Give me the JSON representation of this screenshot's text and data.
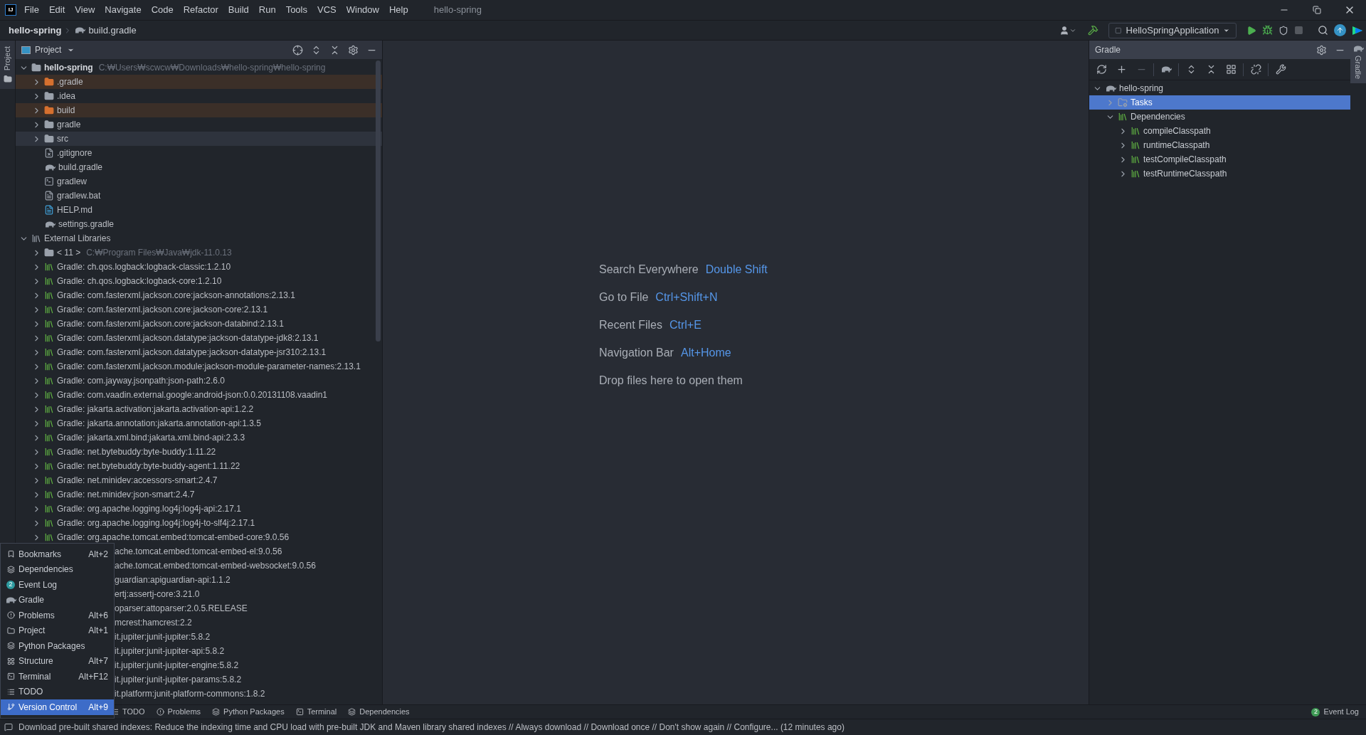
{
  "window": {
    "logo_text": "IJ",
    "title": "hello-spring",
    "menu": [
      "File",
      "Edit",
      "View",
      "Navigate",
      "Code",
      "Refactor",
      "Build",
      "Run",
      "Tools",
      "VCS",
      "Window",
      "Help"
    ]
  },
  "navbar": {
    "breadcrumbs": [
      "hello-spring",
      "build.gradle"
    ],
    "run_config": "HelloSpringApplication"
  },
  "left_strip": {
    "label": "Project"
  },
  "project": {
    "title": "Project",
    "tree": [
      {
        "kind": "module",
        "label": "hello-spring",
        "path": "C:₩Users₩scwcw₩Downloads₩hello-spring₩hello-spring",
        "expanded": true,
        "selected": false,
        "children": [
          {
            "kind": "excluded",
            "label": ".gradle",
            "expanded": false,
            "selected": false
          },
          {
            "kind": "folder",
            "label": ".idea",
            "expanded": false,
            "selected": false
          },
          {
            "kind": "excluded",
            "label": "build",
            "expanded": false,
            "selected": false
          },
          {
            "kind": "folder",
            "label": "gradle",
            "expanded": false,
            "selected": false
          },
          {
            "kind": "folder",
            "label": "src",
            "expanded": false,
            "selected": true
          },
          {
            "kind": "gitignore",
            "label": ".gitignore",
            "selected": false
          },
          {
            "kind": "gradle-file",
            "label": "build.gradle",
            "selected": false
          },
          {
            "kind": "script",
            "label": "gradlew",
            "selected": false
          },
          {
            "kind": "text-file",
            "label": "gradlew.bat",
            "selected": false
          },
          {
            "kind": "markdown",
            "label": "HELP.md",
            "selected": false
          },
          {
            "kind": "gradle-file",
            "label": "settings.gradle",
            "selected": false
          }
        ]
      },
      {
        "kind": "libraries",
        "label": "External Libraries",
        "expanded": true,
        "selected": false,
        "children": [
          {
            "kind": "jdk",
            "label": "< 11 >",
            "path": "C:₩Program Files₩Java₩jdk-11.0.13",
            "expanded": false,
            "selected": false
          },
          {
            "kind": "library",
            "label": "Gradle: ch.qos.logback:logback-classic:1.2.10",
            "expanded": false,
            "selected": false
          },
          {
            "kind": "library",
            "label": "Gradle: ch.qos.logback:logback-core:1.2.10",
            "expanded": false,
            "selected": false
          },
          {
            "kind": "library",
            "label": "Gradle: com.fasterxml.jackson.core:jackson-annotations:2.13.1",
            "expanded": false,
            "selected": false
          },
          {
            "kind": "library",
            "label": "Gradle: com.fasterxml.jackson.core:jackson-core:2.13.1",
            "expanded": false,
            "selected": false
          },
          {
            "kind": "library",
            "label": "Gradle: com.fasterxml.jackson.core:jackson-databind:2.13.1",
            "expanded": false,
            "selected": false
          },
          {
            "kind": "library",
            "label": "Gradle: com.fasterxml.jackson.datatype:jackson-datatype-jdk8:2.13.1",
            "expanded": false,
            "selected": false
          },
          {
            "kind": "library",
            "label": "Gradle: com.fasterxml.jackson.datatype:jackson-datatype-jsr310:2.13.1",
            "expanded": false,
            "selected": false
          },
          {
            "kind": "library",
            "label": "Gradle: com.fasterxml.jackson.module:jackson-module-parameter-names:2.13.1",
            "expanded": false,
            "selected": false
          },
          {
            "kind": "library",
            "label": "Gradle: com.jayway.jsonpath:json-path:2.6.0",
            "expanded": false,
            "selected": false
          },
          {
            "kind": "library",
            "label": "Gradle: com.vaadin.external.google:android-json:0.0.20131108.vaadin1",
            "expanded": false,
            "selected": false
          },
          {
            "kind": "library",
            "label": "Gradle: jakarta.activation:jakarta.activation-api:1.2.2",
            "expanded": false,
            "selected": false
          },
          {
            "kind": "library",
            "label": "Gradle: jakarta.annotation:jakarta.annotation-api:1.3.5",
            "expanded": false,
            "selected": false
          },
          {
            "kind": "library",
            "label": "Gradle: jakarta.xml.bind:jakarta.xml.bind-api:2.3.3",
            "expanded": false,
            "selected": false
          },
          {
            "kind": "library",
            "label": "Gradle: net.bytebuddy:byte-buddy:1.11.22",
            "expanded": false,
            "selected": false
          },
          {
            "kind": "library",
            "label": "Gradle: net.bytebuddy:byte-buddy-agent:1.11.22",
            "expanded": false,
            "selected": false
          },
          {
            "kind": "library",
            "label": "Gradle: net.minidev:accessors-smart:2.4.7",
            "expanded": false,
            "selected": false
          },
          {
            "kind": "library",
            "label": "Gradle: net.minidev:json-smart:2.4.7",
            "expanded": false,
            "selected": false
          },
          {
            "kind": "library",
            "label": "Gradle: org.apache.logging.log4j:log4j-api:2.17.1",
            "expanded": false,
            "selected": false
          },
          {
            "kind": "library",
            "label": "Gradle: org.apache.logging.log4j:log4j-to-slf4j:2.17.1",
            "expanded": false,
            "selected": false
          },
          {
            "kind": "library",
            "label": "Gradle: org.apache.tomcat.embed:tomcat-embed-core:9.0.56",
            "expanded": false,
            "selected": false
          },
          {
            "kind": "clipped",
            "label": "ache.tomcat.embed:tomcat-embed-el:9.0.56",
            "selected": false
          },
          {
            "kind": "clipped",
            "label": "ache.tomcat.embed:tomcat-embed-websocket:9.0.56",
            "selected": false
          },
          {
            "kind": "clipped",
            "label": "guardian:apiguardian-api:1.1.2",
            "selected": false
          },
          {
            "kind": "clipped",
            "label": "ertj:assertj-core:3.21.0",
            "selected": false
          },
          {
            "kind": "clipped",
            "label": "oparser:attoparser:2.0.5.RELEASE",
            "selected": false
          },
          {
            "kind": "clipped",
            "label": "mcrest:hamcrest:2.2",
            "selected": false
          },
          {
            "kind": "clipped",
            "label": "it.jupiter:junit-jupiter:5.8.2",
            "selected": false
          },
          {
            "kind": "clipped",
            "label": "it.jupiter:junit-jupiter-api:5.8.2",
            "selected": false
          },
          {
            "kind": "clipped",
            "label": "it.jupiter:junit-jupiter-engine:5.8.2",
            "selected": false
          },
          {
            "kind": "clipped",
            "label": "it.jupiter:junit-jupiter-params:5.8.2",
            "selected": false
          },
          {
            "kind": "clipped",
            "label": "it.platform:junit-platform-commons:1.8.2",
            "selected": false
          }
        ]
      }
    ]
  },
  "editor": {
    "hints": [
      {
        "label": "Search Everywhere",
        "shortcut": "Double Shift"
      },
      {
        "label": "Go to File",
        "shortcut": "Ctrl+Shift+N"
      },
      {
        "label": "Recent Files",
        "shortcut": "Ctrl+E"
      },
      {
        "label": "Navigation Bar",
        "shortcut": "Alt+Home"
      },
      {
        "label": "Drop files here to open them"
      }
    ]
  },
  "gradle": {
    "title": "Gradle",
    "tree": [
      {
        "kind": "project",
        "label": "hello-spring",
        "expanded": true,
        "selected": false,
        "children": [
          {
            "kind": "tasks",
            "label": "Tasks",
            "expanded": false,
            "selected": true
          },
          {
            "kind": "dependencies",
            "label": "Dependencies",
            "expanded": true,
            "selected": false,
            "children": [
              {
                "kind": "dependencies",
                "label": "compileClasspath",
                "expanded": false,
                "selected": false
              },
              {
                "kind": "dependencies",
                "label": "runtimeClasspath",
                "expanded": false,
                "selected": false
              },
              {
                "kind": "dependencies",
                "label": "testCompileClasspath",
                "expanded": false,
                "selected": false
              },
              {
                "kind": "dependencies",
                "label": "testRuntimeClasspath",
                "expanded": false,
                "selected": false
              }
            ]
          }
        ]
      }
    ]
  },
  "right_strip": {
    "label": "Gradle"
  },
  "tool_window_menu": [
    {
      "label": "Bookmarks",
      "shortcut": "Alt+2",
      "selected": false
    },
    {
      "label": "Dependencies",
      "selected": false
    },
    {
      "label": "Event Log",
      "badge": "2",
      "selected": false
    },
    {
      "label": "Gradle",
      "selected": false
    },
    {
      "label": "Problems",
      "shortcut": "Alt+6",
      "selected": false
    },
    {
      "label": "Project",
      "shortcut": "Alt+1",
      "selected": false
    },
    {
      "label": "Python Packages",
      "selected": false
    },
    {
      "label": "Structure",
      "shortcut": "Alt+7",
      "selected": false
    },
    {
      "label": "Terminal",
      "shortcut": "Alt+F12",
      "selected": false
    },
    {
      "label": "TODO",
      "selected": false
    },
    {
      "label": "Version Control",
      "shortcut": "Alt+9",
      "selected": true
    }
  ],
  "bottom_bar": {
    "tabs": [
      "TODO",
      "Problems",
      "Python Packages",
      "Terminal",
      "Dependencies"
    ],
    "event_log": {
      "label": "Event Log",
      "badge": "2"
    }
  },
  "status_bar": {
    "message": "Download pre-built shared indexes: Reduce the indexing time and CPU load with pre-built JDK and Maven library shared indexes // Always download // Download once // Don't show again // Configure... (12 minutes ago)"
  }
}
